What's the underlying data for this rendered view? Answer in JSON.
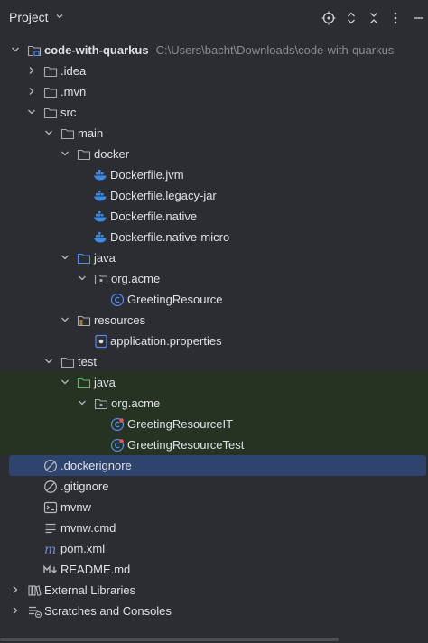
{
  "panel": {
    "title": "Project"
  },
  "tree": {
    "root": {
      "label": "code-with-quarkus",
      "path": "C:\\Users\\bacht\\Downloads\\code-with-quarkus"
    },
    "idea": ".idea",
    "mvn": ".mvn",
    "src": "src",
    "main": "main",
    "docker": "docker",
    "dockerfile_jvm": "Dockerfile.jvm",
    "dockerfile_legacy": "Dockerfile.legacy-jar",
    "dockerfile_native": "Dockerfile.native",
    "dockerfile_native_micro": "Dockerfile.native-micro",
    "java": "java",
    "org_acme": "org.acme",
    "greeting_resource": "GreetingResource",
    "resources": "resources",
    "app_properties": "application.properties",
    "test": "test",
    "test_java": "java",
    "test_org_acme": "org.acme",
    "greeting_it": "GreetingResourceIT",
    "greeting_test": "GreetingResourceTest",
    "dockerignore": ".dockerignore",
    "gitignore": ".gitignore",
    "mvnw": "mvnw",
    "mvnw_cmd": "mvnw.cmd",
    "pom": "pom.xml",
    "readme": "README.md",
    "external_libraries": "External Libraries",
    "scratches": "Scratches and Consoles"
  },
  "colors": {
    "background": "#2b2d30",
    "selection": "#2e436e",
    "test_highlight": "#263323",
    "folder": "#a9abb0",
    "source_folder": "#548af7",
    "test_folder": "#5fb865",
    "docker": "#3d8be8"
  }
}
